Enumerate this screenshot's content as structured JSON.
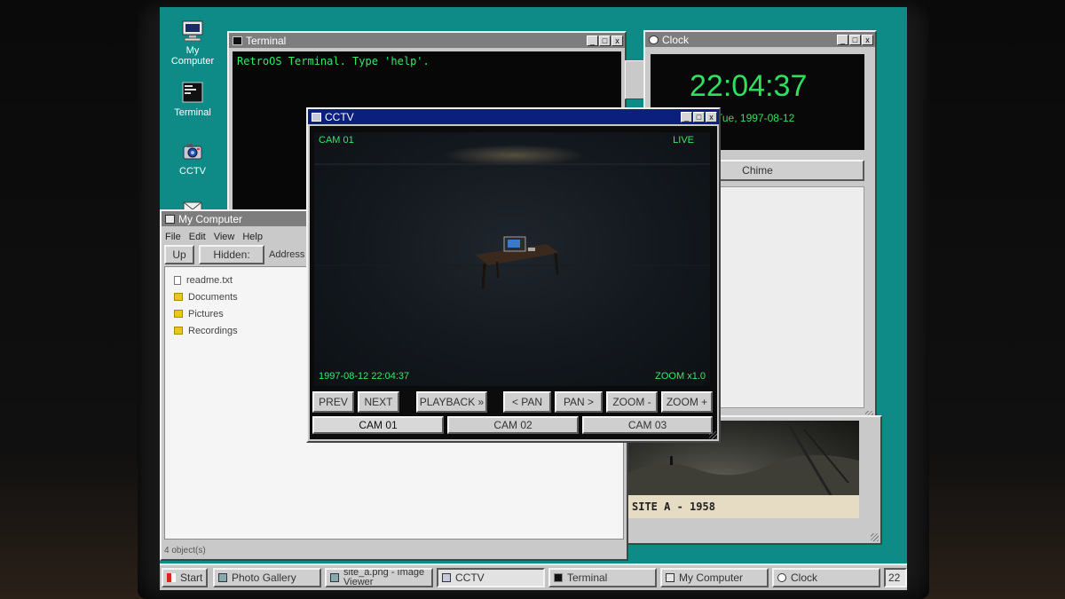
{
  "desktop_icons": [
    {
      "label_line1": "My",
      "label_line2": "Computer",
      "icon": "computer-icon"
    },
    {
      "label_line1": "Terminal",
      "label_line2": "",
      "icon": "terminal-icon"
    },
    {
      "label_line1": "CCTV",
      "label_line2": "",
      "icon": "camera-icon"
    },
    {
      "label_line1": "",
      "label_line2": "",
      "icon": "mail-icon"
    }
  ],
  "terminal": {
    "title": "Terminal",
    "line": "RetroOS Terminal. Type 'help'."
  },
  "clock": {
    "title": "Clock",
    "time": "22:04:37",
    "date": "Tue, 1997-08-12",
    "chime": "Chime"
  },
  "my_computer": {
    "title": "My Computer",
    "menu": [
      "File",
      "Edit",
      "View",
      "Help"
    ],
    "toolbar": {
      "up": "Up",
      "hidden": "Hidden: Off",
      "address": "Address"
    },
    "files": [
      {
        "name": "readme.txt",
        "type": "doc"
      },
      {
        "name": "Documents",
        "type": "folder"
      },
      {
        "name": "Pictures",
        "type": "folder"
      },
      {
        "name": "Recordings",
        "type": "folder"
      }
    ],
    "status": "4 object(s)"
  },
  "photo": {
    "caption": "SITE A - 1958"
  },
  "cctv": {
    "title": "CCTV",
    "cam_label": "CAM 01",
    "live": "LIVE",
    "timestamp": "1997-08-12 22:04:37",
    "zoom": "ZOOM x1.0",
    "buttons": {
      "prev": "PREV",
      "next": "NEXT",
      "playback": "PLAYBACK »",
      "pan_left": "< PAN",
      "pan_right": "PAN >",
      "zoom_out": "ZOOM -",
      "zoom_in": "ZOOM +"
    },
    "cams": [
      "CAM 01",
      "CAM 02",
      "CAM 03"
    ]
  },
  "taskbar": {
    "start": "Start",
    "tasks": [
      "Photo Gallery",
      "site_a.png - Image Viewer",
      "CCTV",
      "Terminal",
      "My Computer",
      "Clock"
    ],
    "tray": "22"
  },
  "colors": {
    "desktop": "#0e8a87",
    "titlebar_active": "#0b1f7d",
    "titlebar_inactive": "#7d7d7d",
    "terminal_text": "#33e86a"
  }
}
